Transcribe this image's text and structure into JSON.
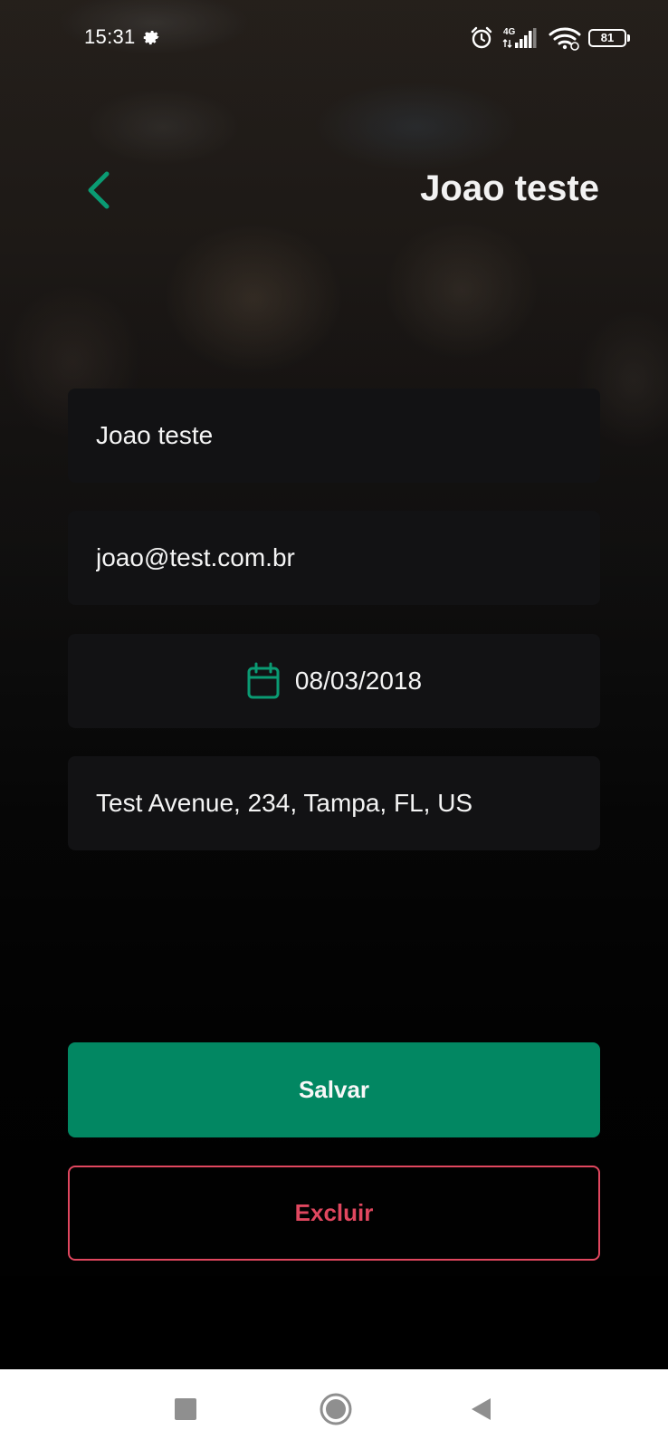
{
  "status_bar": {
    "time": "15:31",
    "network": "4G",
    "battery": "81"
  },
  "header": {
    "title": "Joao teste"
  },
  "form": {
    "name": "Joao teste",
    "email": "joao@test.com.br",
    "birth_date": "08/03/2018",
    "address": "Test Avenue, 234, Tampa, FL, US"
  },
  "actions": {
    "save_label": "Salvar",
    "delete_label": "Excluir"
  },
  "colors": {
    "accent": "#028762",
    "danger": "#e0475f",
    "field_bg": "#121214"
  }
}
